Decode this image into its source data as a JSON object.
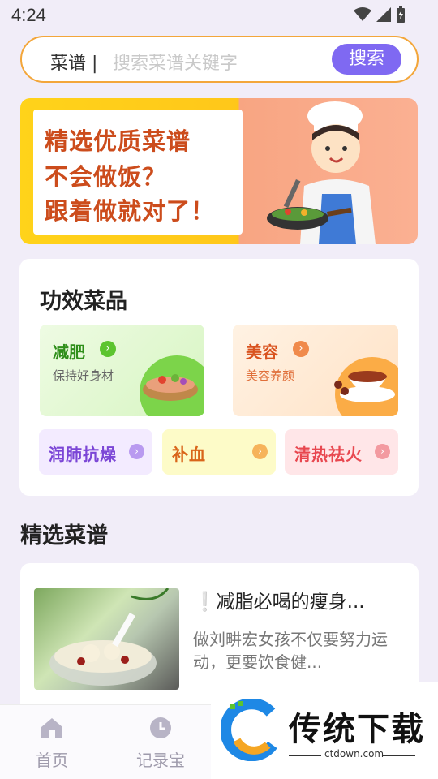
{
  "status": {
    "time": "4:24"
  },
  "search": {
    "label": "菜谱 |",
    "placeholder": "搜索菜谱关键字",
    "button": "搜索"
  },
  "banner": {
    "lines": [
      "精选优质菜谱",
      "不会做饭？",
      "跟着做就对了！"
    ]
  },
  "efficacy": {
    "title": "功效菜品",
    "big": [
      {
        "name": "减肥",
        "sub": "保持好身材",
        "color": "#2f8f1a"
      },
      {
        "name": "美容",
        "sub": "美容养颜",
        "color": "#d9531f"
      }
    ],
    "small": [
      {
        "name": "润肺抗燥",
        "color": "#7b46d6"
      },
      {
        "name": "补血",
        "color": "#d9651a"
      },
      {
        "name": "清热祛火",
        "color": "#e8474f"
      }
    ]
  },
  "featured": {
    "title": "精选菜谱",
    "item": {
      "title": "❕减脂必喝的瘦身...",
      "desc": "做刘畊宏女孩不仅要努力运动，更要饮食健..."
    }
  },
  "nav": {
    "home": "首页",
    "records": "记录宝"
  },
  "watermark": {
    "text": "传统下载",
    "url": "ctdown.com"
  }
}
